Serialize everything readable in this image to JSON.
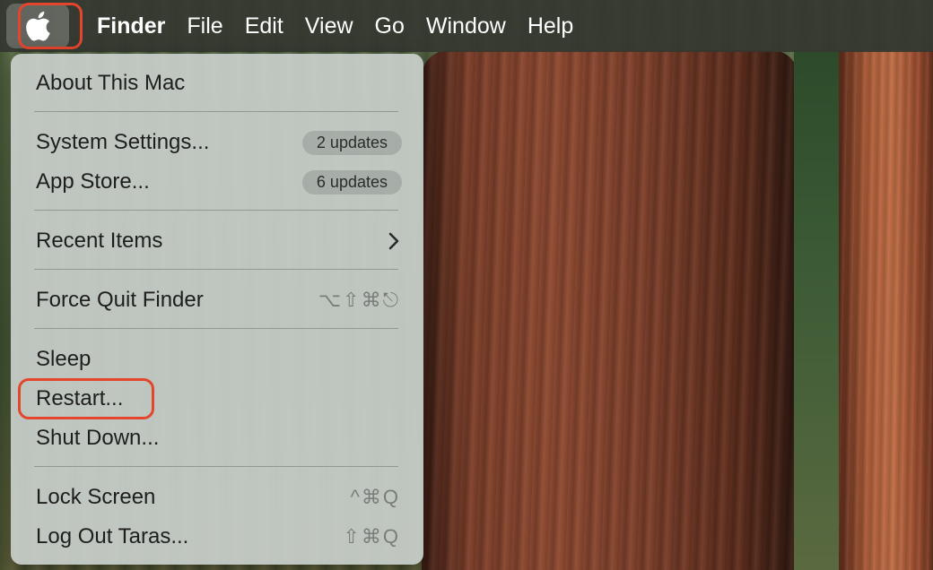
{
  "menubar": {
    "apple_icon": "apple-logo-icon",
    "items": [
      "Finder",
      "File",
      "Edit",
      "View",
      "Go",
      "Window",
      "Help"
    ]
  },
  "apple_menu": {
    "about": "About This Mac",
    "system_settings": {
      "label": "System Settings...",
      "badge": "2 updates"
    },
    "app_store": {
      "label": "App Store...",
      "badge": "6 updates"
    },
    "recent_items": {
      "label": "Recent Items",
      "icon": "chevron-right-icon"
    },
    "force_quit": {
      "label": "Force Quit Finder",
      "shortcut": "⌥⇧⌘⎋"
    },
    "sleep": "Sleep",
    "restart": "Restart...",
    "shut_down": "Shut Down...",
    "lock_screen": {
      "label": "Lock Screen",
      "shortcut": "^⌘Q"
    },
    "log_out": {
      "label": "Log Out Taras...",
      "shortcut": "⇧⌘Q"
    }
  },
  "colors": {
    "highlight": "#e3452d",
    "menu_background": "#c8cfca",
    "menubar_background": "#343730"
  }
}
